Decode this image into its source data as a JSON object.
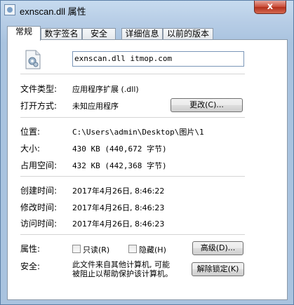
{
  "window": {
    "title": "exnscan.dll 属性",
    "close_label": "x"
  },
  "tabs": [
    {
      "label": "常规",
      "active": true
    },
    {
      "label": "数字签名",
      "active": false
    },
    {
      "label": "安全",
      "active": false
    },
    {
      "label": "详细信息",
      "active": false
    },
    {
      "label": "以前的版本",
      "active": false
    }
  ],
  "general": {
    "file_name": "exnscan.dll itmop.com",
    "file_type_label": "文件类型:",
    "file_type_value": "应用程序扩展 (.dll)",
    "open_with_label": "打开方式:",
    "open_with_value": "未知应用程序",
    "change_button": "更改(C)...",
    "location_label": "位置:",
    "location_value": "C:\\Users\\admin\\Desktop\\图片\\1",
    "size_label": "大小:",
    "size_value": "430 KB (440,672 字节)",
    "size_on_disk_label": "占用空间:",
    "size_on_disk_value": "432 KB (442,368 字节)",
    "created_label": "创建时间:",
    "created_value": "2017年4月26日, 8:46:22",
    "modified_label": "修改时间:",
    "modified_value": "2017年4月26日, 8:46:23",
    "accessed_label": "访问时间:",
    "accessed_value": "2017年4月26日, 8:46:23",
    "attributes_label": "属性:",
    "readonly_label": "只读(R)",
    "readonly_checked": false,
    "hidden_label": "隐藏(H)",
    "hidden_checked": false,
    "advanced_button": "高级(D)...",
    "security_label": "安全:",
    "security_text_line1": "此文件来自其他计算机, 可能",
    "security_text_line2": "被阻止以帮助保护该计算机。",
    "unblock_button": "解除锁定(K)"
  },
  "icons": {
    "app": "dll-file-icon",
    "file": "dll-gear-file-icon"
  }
}
